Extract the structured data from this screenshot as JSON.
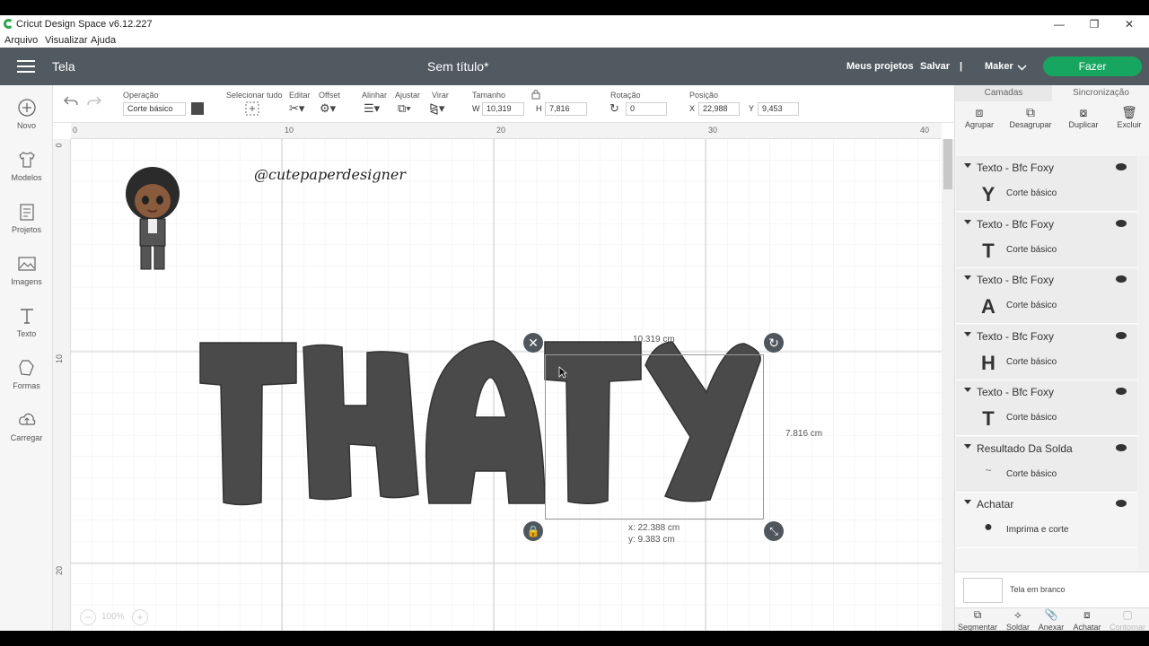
{
  "window": {
    "title": "Cricut Design Space  v6.12.227",
    "min": "—",
    "max": "❐",
    "close": "✕"
  },
  "menu": [
    "Arquivo",
    "Visualizar",
    "Ajuda"
  ],
  "header": {
    "section": "Tela",
    "document": "Sem título*",
    "my_projects": "Meus projetos",
    "save": "Salvar",
    "separator": "|",
    "machine": "Maker",
    "make": "Fazer"
  },
  "left_tools": [
    {
      "label": "Novo",
      "icon": "plus-circle-icon"
    },
    {
      "label": "Modelos",
      "icon": "shirt-icon"
    },
    {
      "label": "Projetos",
      "icon": "projects-icon"
    },
    {
      "label": "Imagens",
      "icon": "image-icon"
    },
    {
      "label": "Texto",
      "icon": "text-icon"
    },
    {
      "label": "Formas",
      "icon": "shapes-icon"
    },
    {
      "label": "Carregar",
      "icon": "upload-icon"
    }
  ],
  "editbar": {
    "operation_label": "Operação",
    "operation_value": "Corte básico",
    "select_all": "Selecionar tudo",
    "edit": "Editar",
    "offset": "Offset",
    "align": "Alinhar",
    "arrange": "Ajustar",
    "flip": "Virar",
    "size_label": "Tamanho",
    "w_label": "W",
    "w_value": "10,319",
    "h_label": "H",
    "h_value": "7,816",
    "rotation_label": "Rotação",
    "rotation_value": "0",
    "position_label": "Posição",
    "x_label": "X",
    "x_value": "22,988",
    "y_label": "Y",
    "y_value": "9,453"
  },
  "ruler": {
    "top": [
      "0",
      "10",
      "20",
      "30",
      "40"
    ],
    "left": [
      "0",
      "10",
      "20"
    ]
  },
  "canvas": {
    "watermark": "@cutepaperdesigner",
    "letters": [
      "T",
      "H",
      "A",
      "T",
      "Y"
    ],
    "width_label": "10.319 cm",
    "height_label": "7.816 cm",
    "pos_x_label": "x: 22.388 cm",
    "pos_y_label": "y: 9.383 cm",
    "zoom": "100%"
  },
  "panel": {
    "tabs": [
      "Camadas",
      "Sincronização"
    ],
    "tools": [
      "Agrupar",
      "Desagrupar",
      "Duplicar",
      "Excluir"
    ],
    "layers": [
      {
        "name": "Texto - Bfc Foxy",
        "thumb": "Y",
        "op": "Corte básico"
      },
      {
        "name": "Texto - Bfc Foxy",
        "thumb": "T",
        "op": "Corte básico"
      },
      {
        "name": "Texto - Bfc Foxy",
        "thumb": "A",
        "op": "Corte básico"
      },
      {
        "name": "Texto - Bfc Foxy",
        "thumb": "H",
        "op": "Corte básico"
      },
      {
        "name": "Texto - Bfc Foxy",
        "thumb": "T",
        "op": "Corte básico"
      },
      {
        "name": "Resultado Da Solda",
        "thumb": "~",
        "op": "Corte básico"
      },
      {
        "name": "Achatar",
        "thumb": "●",
        "op": "Imprima e corte"
      }
    ],
    "blank_canvas": "Tela em branco",
    "bottom_tools": [
      "Segmentar",
      "Soldar",
      "Anexar",
      "Achatar",
      "Contornar"
    ]
  },
  "colors": {
    "header": "#515a60",
    "make": "#17a660",
    "letters": "#4a4a4a"
  }
}
